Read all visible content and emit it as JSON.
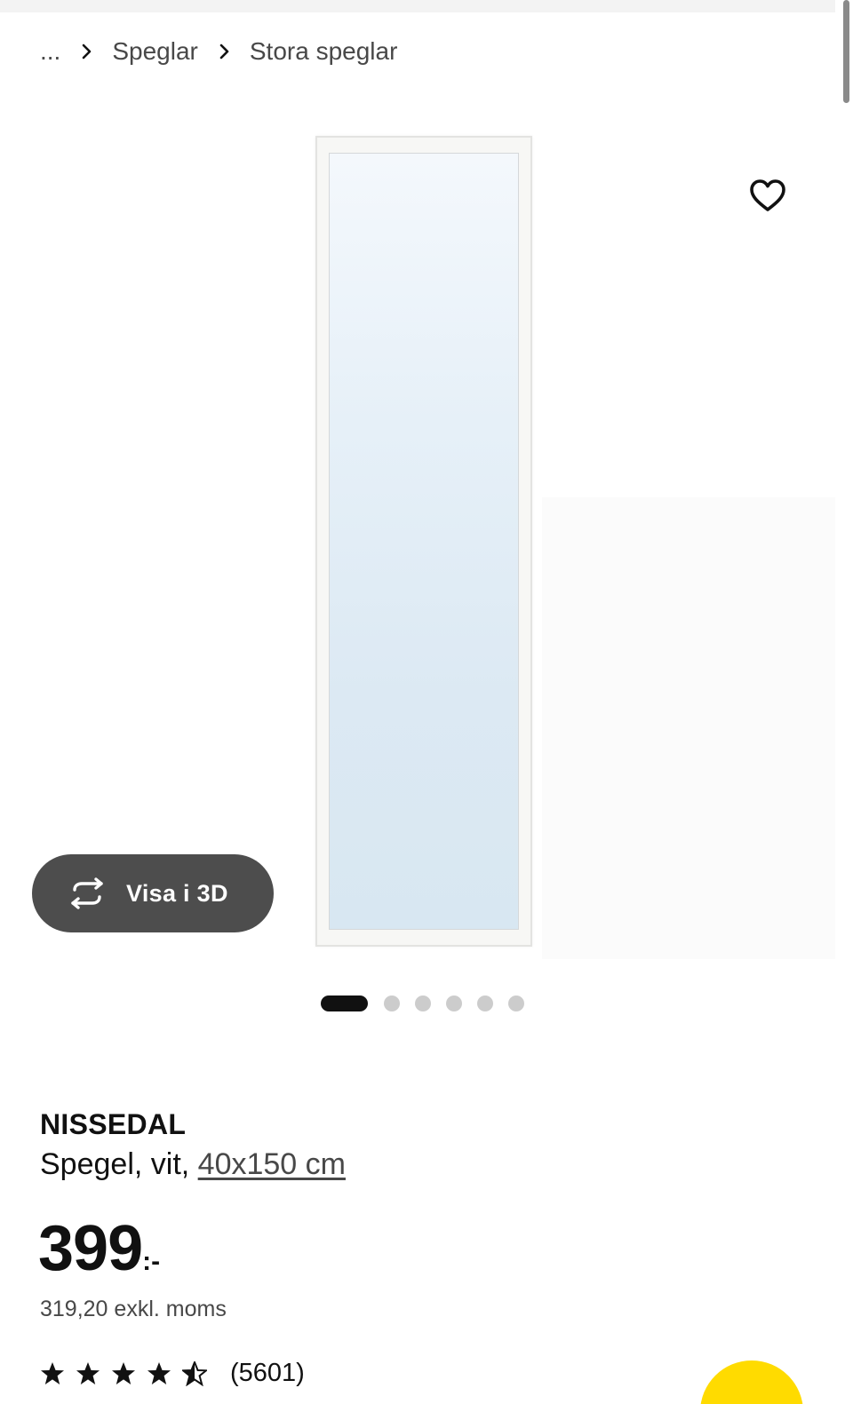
{
  "breadcrumb": {
    "ellipsis": "...",
    "items": [
      "Speglar",
      "Stora speglar"
    ]
  },
  "gallery": {
    "view_3d_label": "Visa i 3D",
    "dots_total": 6,
    "active_dot": 0
  },
  "product": {
    "name": "NISSEDAL",
    "description_prefix": "Spegel, vit, ",
    "size": "40x150 cm",
    "price_integer": "399",
    "price_suffix": ":-",
    "price_excl_vat": "319,20 exkl. moms",
    "rating_value": 4.5,
    "rating_max": 5,
    "rating_count": "(5601)"
  },
  "icons": {
    "favorite": "heart-icon",
    "view3d": "rotate-3d-icon",
    "breadcrumb_separator": "chevron-right-icon",
    "star": "star-icon"
  },
  "colors": {
    "accent_yellow": "#ffdb00",
    "dark_button": "#4d4d4d",
    "text": "#111111",
    "muted_text": "#484848"
  }
}
